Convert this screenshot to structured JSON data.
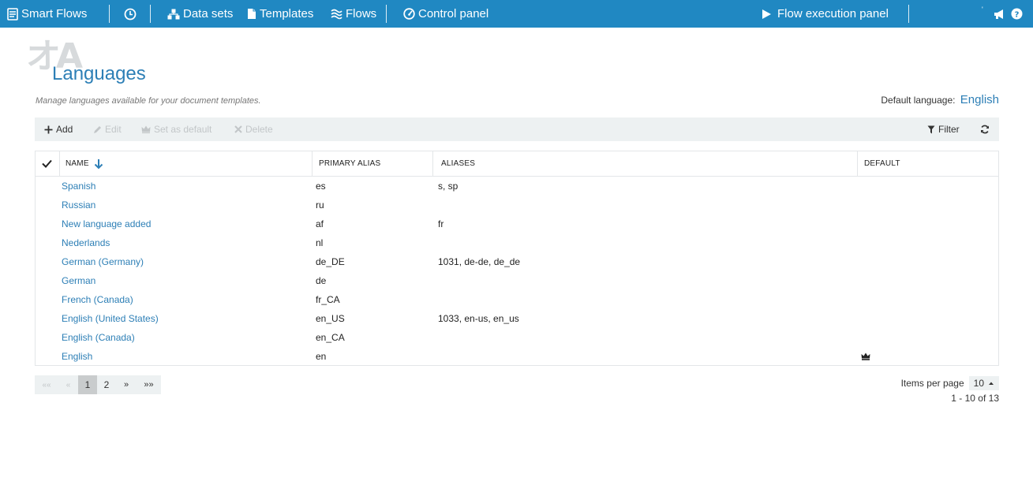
{
  "nav": {
    "brand": "Smart Flows",
    "data_sets": "Data sets",
    "templates": "Templates",
    "flows": "Flows",
    "control_panel": "Control panel",
    "flow_execution_panel": "Flow execution panel",
    "notification_mark": "'"
  },
  "header": {
    "watermark": "オA",
    "title": "Languages",
    "subtitle": "Manage languages available for your document templates.",
    "default_label": "Default language:",
    "default_value": "English"
  },
  "toolbar": {
    "add": "Add",
    "edit": "Edit",
    "set_default": "Set as default",
    "delete": "Delete",
    "filter": "Filter"
  },
  "table": {
    "columns": {
      "name": "NAME",
      "primary_alias": "PRIMARY ALIAS",
      "aliases": "ALIASES",
      "default": "DEFAULT"
    },
    "rows": [
      {
        "name": "Spanish",
        "primary_alias": "es",
        "aliases": "s, sp",
        "is_default": false
      },
      {
        "name": "Russian",
        "primary_alias": "ru",
        "aliases": "",
        "is_default": false
      },
      {
        "name": "New language added",
        "primary_alias": "af",
        "aliases": "fr",
        "is_default": false
      },
      {
        "name": "Nederlands",
        "primary_alias": "nl",
        "aliases": "",
        "is_default": false
      },
      {
        "name": "German (Germany)",
        "primary_alias": "de_DE",
        "aliases": "1031, de-de, de_de",
        "is_default": false
      },
      {
        "name": "German",
        "primary_alias": "de",
        "aliases": "",
        "is_default": false
      },
      {
        "name": "French (Canada)",
        "primary_alias": "fr_CA",
        "aliases": "",
        "is_default": false
      },
      {
        "name": "English (United States)",
        "primary_alias": "en_US",
        "aliases": "1033, en-us, en_us",
        "is_default": false
      },
      {
        "name": "English (Canada)",
        "primary_alias": "en_CA",
        "aliases": "",
        "is_default": false
      },
      {
        "name": "English",
        "primary_alias": "en",
        "aliases": "",
        "is_default": true
      }
    ]
  },
  "pager": {
    "first": "««",
    "prev": "«",
    "page1": "1",
    "page2": "2",
    "next": "»",
    "last": "»»",
    "items_per_page_label": "Items per page",
    "items_per_page_value": "10",
    "range": "1 - 10 of 13"
  },
  "colors": {
    "nav_bg": "#2088c2",
    "accent": "#2d7fb6",
    "toolbar_bg": "#edf1f2"
  }
}
